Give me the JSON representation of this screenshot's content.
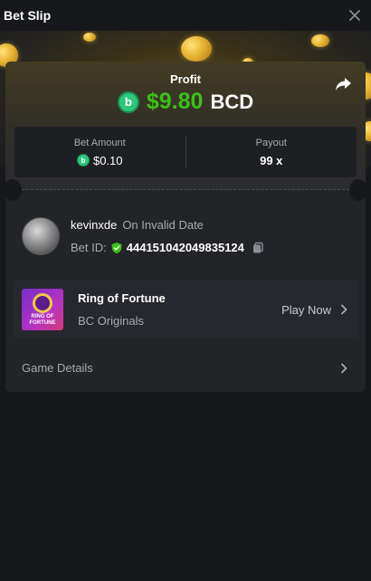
{
  "header": {
    "title": "Bet Slip",
    "close_icon": "close-icon"
  },
  "profit": {
    "label": "Profit",
    "amount": "$9.80",
    "currency": "BCD",
    "amount_color": "#3bc117"
  },
  "stats": {
    "bet_amount_label": "Bet Amount",
    "bet_amount_value": "$0.10",
    "payout_label": "Payout",
    "payout_value": "99 x"
  },
  "user": {
    "name": "kevinxde",
    "date": "On Invalid Date",
    "bet_id_label": "Bet ID:",
    "bet_id": "444151042049835124"
  },
  "game": {
    "name": "Ring of Fortune",
    "provider": "BC Originals",
    "play_label": "Play Now",
    "thumb_title": "RING OF FORTUNE"
  },
  "details": {
    "label": "Game Details"
  },
  "colors": {
    "accent_green": "#3bc117",
    "coin_green": "#2ec77a",
    "background": "#17181b",
    "card": "#232428"
  }
}
